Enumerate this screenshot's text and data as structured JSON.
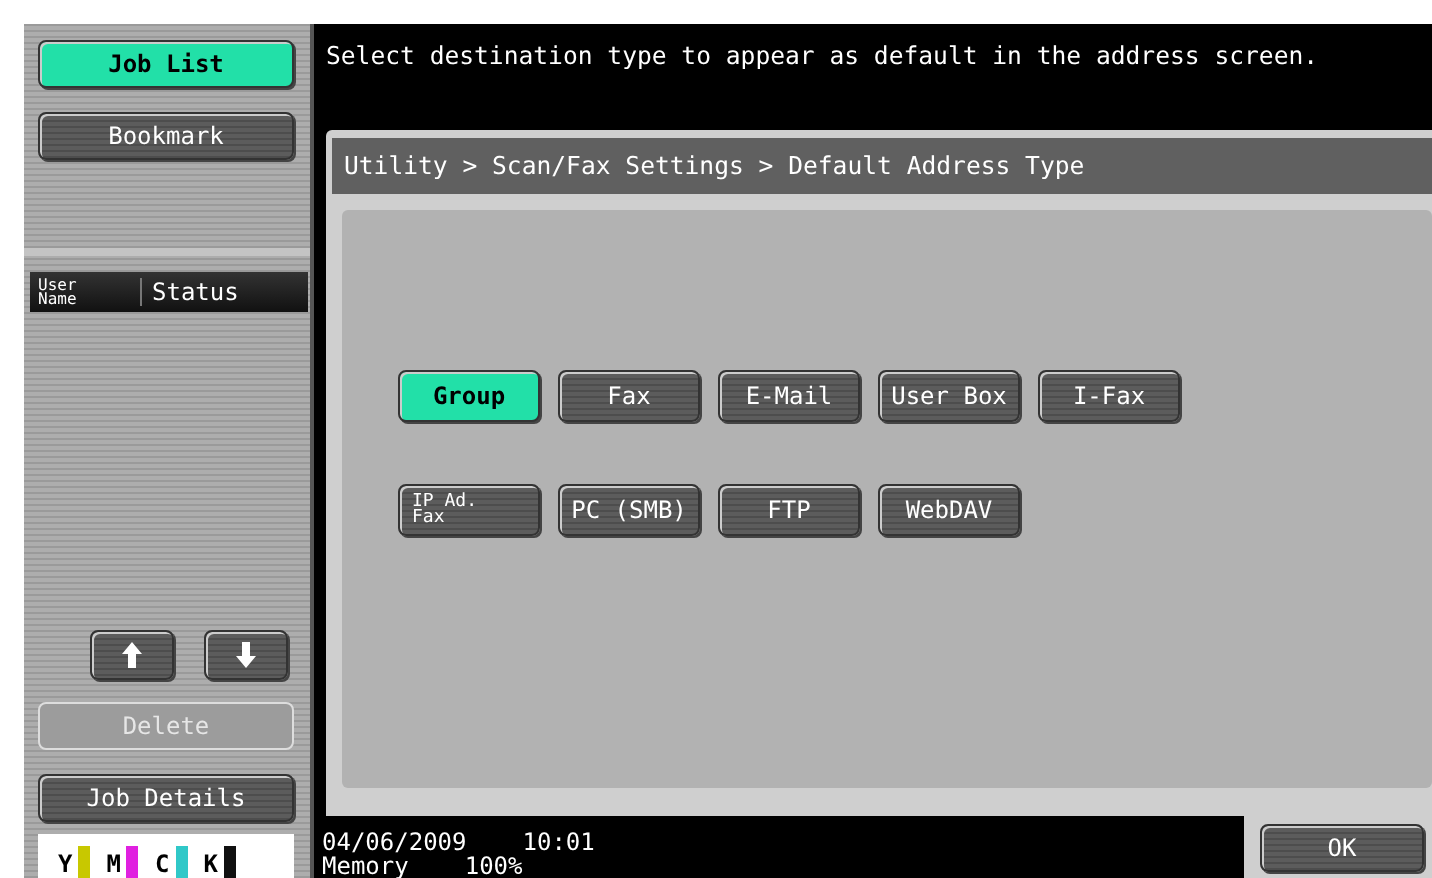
{
  "sidebar": {
    "nav": [
      {
        "label": "Job List",
        "selected": true
      },
      {
        "label": "Bookmark",
        "selected": false
      }
    ],
    "job_table": {
      "columns": [
        "User Name",
        "Status"
      ]
    },
    "scroll_buttons": [
      {
        "kind": "up"
      },
      {
        "kind": "down"
      }
    ],
    "delete_button": {
      "label": "Delete",
      "disabled": true
    },
    "job_details_button": {
      "label": "Job Details"
    },
    "toner": [
      {
        "label": "Y",
        "color": "#c8c800"
      },
      {
        "label": "M",
        "color": "#e020e0"
      },
      {
        "label": "C",
        "color": "#30c8c8"
      },
      {
        "label": "K",
        "color": "#101010"
      }
    ]
  },
  "message": "Select destination type to appear as default in the address screen.",
  "breadcrumb": "Utility > Scan/Fax Settings > Default Address Type",
  "address_types": [
    [
      {
        "label": "Group",
        "selected": true
      },
      {
        "label": "Fax",
        "selected": false
      },
      {
        "label": "E-Mail",
        "selected": false
      },
      {
        "label": "User Box",
        "selected": false
      },
      {
        "label": "I-Fax",
        "selected": false
      }
    ],
    [
      {
        "label": "IP Ad. Fax",
        "selected": false,
        "kind": "stacked"
      },
      {
        "label": "PC (SMB)",
        "selected": false
      },
      {
        "label": "FTP",
        "selected": false
      },
      {
        "label": "WebDAV",
        "selected": false
      }
    ]
  ],
  "status_bar": {
    "date": "04/06/2009",
    "time": "10:01",
    "memory_label": "Memory",
    "memory_value": "100%"
  },
  "ok_button": "OK"
}
